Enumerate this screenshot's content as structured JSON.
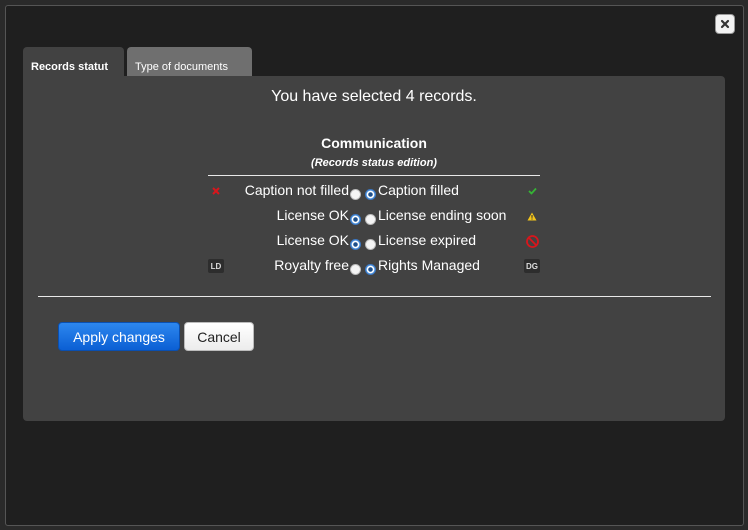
{
  "tabs": [
    {
      "label": "Records statut",
      "active": true
    },
    {
      "label": "Type of documents",
      "active": false
    }
  ],
  "headline": "You have selected 4 records.",
  "section": {
    "title": "Communication",
    "subtitle": "(Records status edition)"
  },
  "status_rows": [
    {
      "left_label": "Caption not filled",
      "right_label": "Caption filled",
      "selected": "right",
      "left_icon": "red-x-icon",
      "right_icon": "green-check-icon"
    },
    {
      "left_label": "License OK",
      "right_label": "License ending soon",
      "selected": "left",
      "left_icon": "",
      "right_icon": "warning-triangle-icon"
    },
    {
      "left_label": "License OK",
      "right_label": "License expired",
      "selected": "left",
      "left_icon": "",
      "right_icon": "no-entry-icon"
    },
    {
      "left_label": "Royalty free",
      "right_label": "Rights Managed",
      "selected": "right",
      "left_icon": "LD",
      "right_icon": "DG"
    }
  ],
  "buttons": {
    "apply": "Apply changes",
    "cancel": "Cancel"
  },
  "colors": {
    "accent": "#1a6fe0",
    "panel": "#424242",
    "check": "#35b535",
    "warning": "#f2c41b",
    "error": "#d8161c"
  }
}
